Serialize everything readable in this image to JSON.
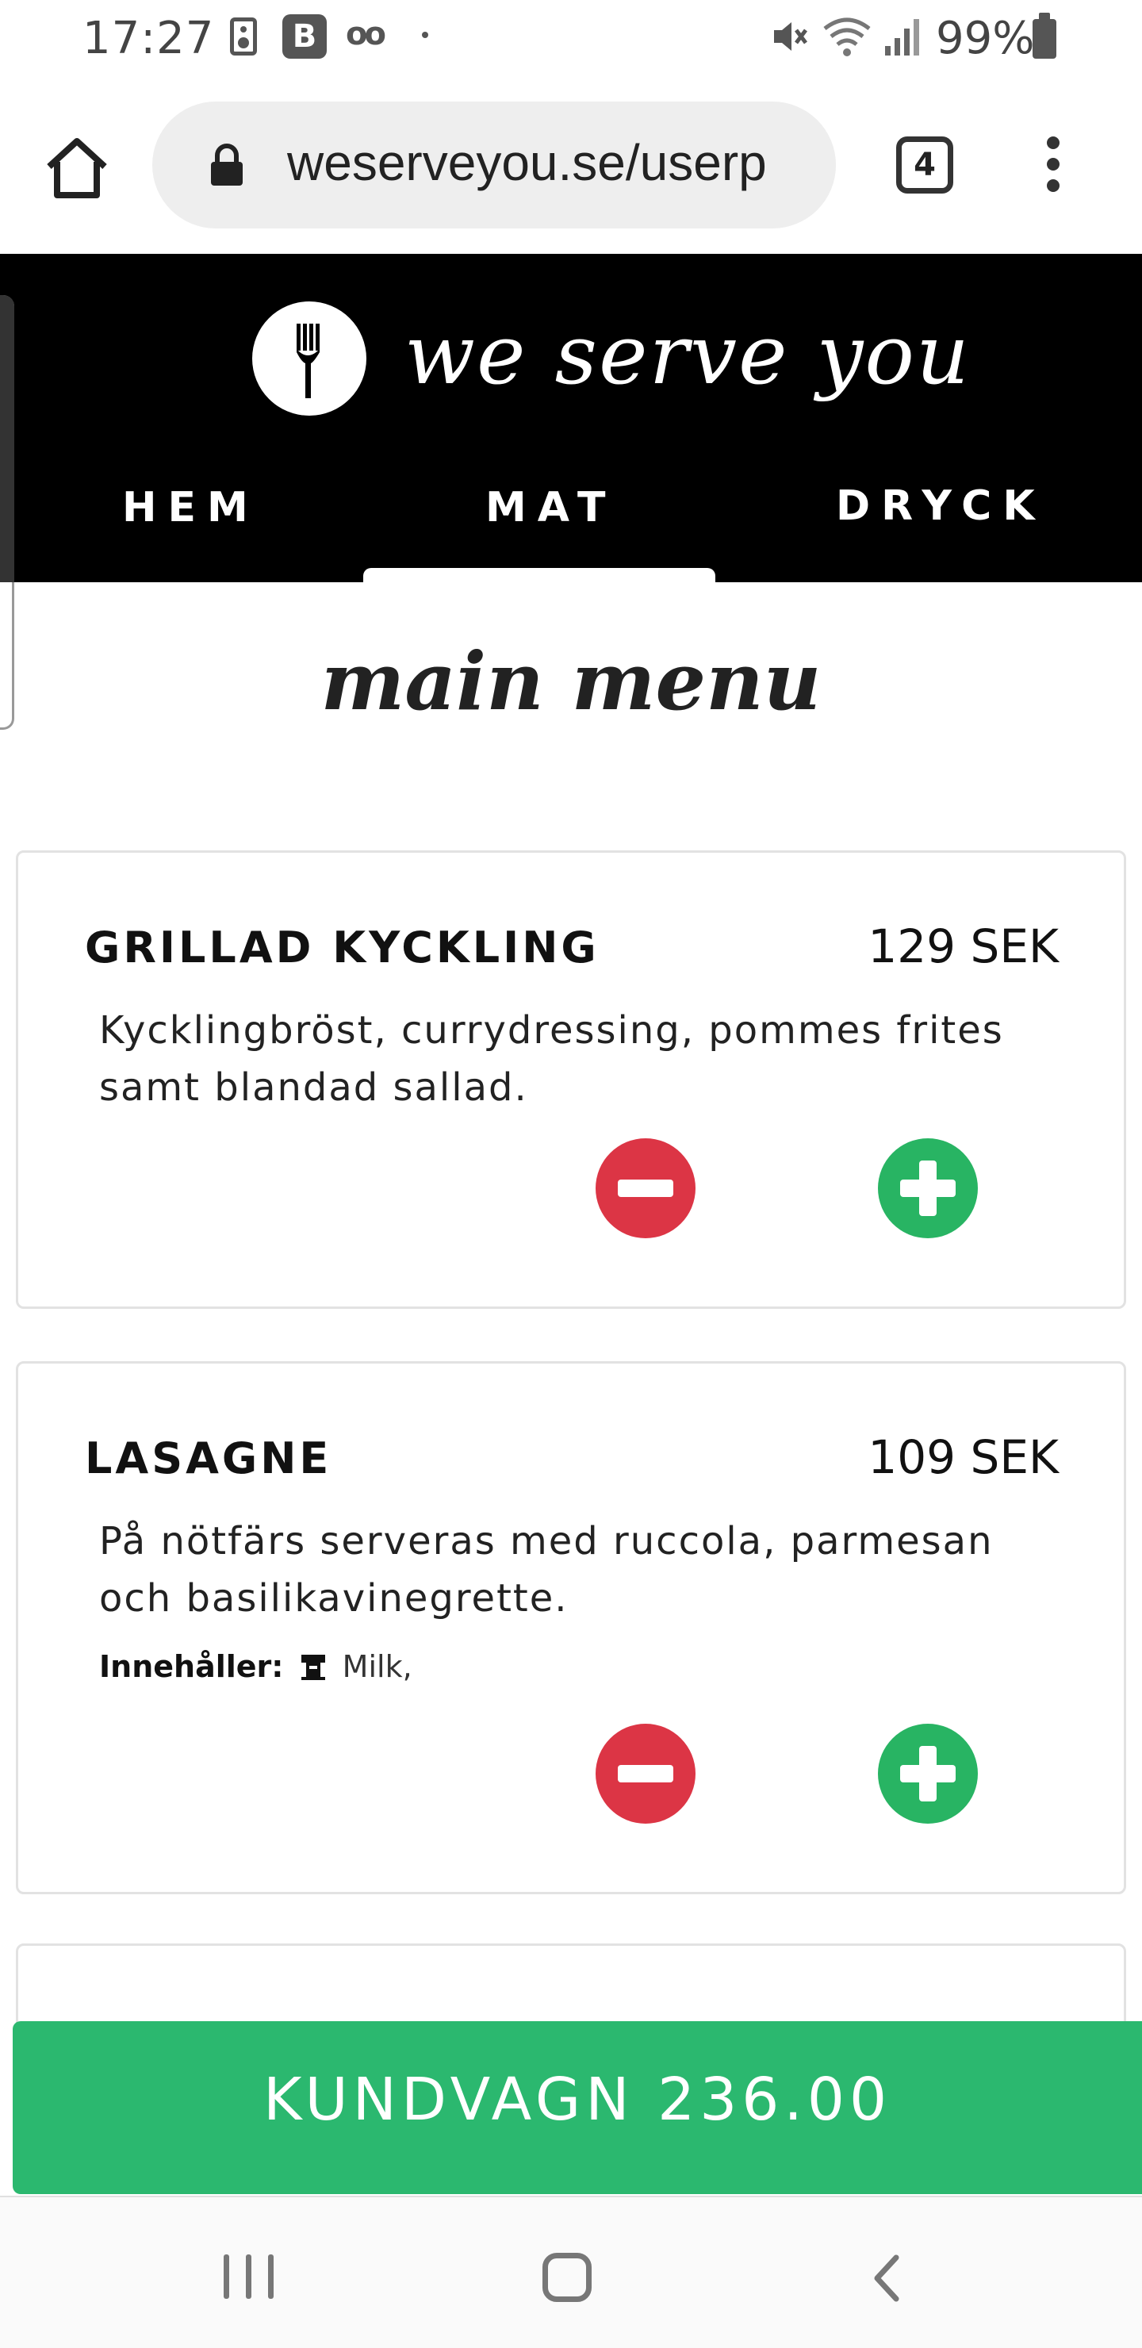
{
  "status_bar": {
    "time": "17:27",
    "b_badge": "B",
    "voicemail_glyph": "oo",
    "battery_percent": "99%",
    "icons": [
      "speaker-icon",
      "b-badge-icon",
      "voicemail-icon",
      "mute-icon",
      "wifi-icon",
      "signal-icon",
      "battery-icon"
    ]
  },
  "browser": {
    "url": "weserveyou.se/userp",
    "tab_count": "4",
    "icons": [
      "home-icon",
      "lock-icon",
      "tabs-icon",
      "more-vert-icon"
    ]
  },
  "site": {
    "logo_text": "we serve you",
    "nav": [
      {
        "label": "HEM",
        "active": false
      },
      {
        "label": "MAT",
        "active": true
      },
      {
        "label": "DRYCK",
        "active": false
      }
    ],
    "heading": "main menu"
  },
  "menu_items": [
    {
      "name": "GRILLAD KYCKLING",
      "price": "129 SEK",
      "description": "Kycklingbröst, currydressing, pommes frites samt blandad sallad."
    },
    {
      "name": "LASAGNE",
      "price": "109 SEK",
      "description": "På nötfärs serveras med ruccola, parmesan och basilikavinegrette.",
      "contains_label": "Innehåller:",
      "contains_value": "Milk,"
    }
  ],
  "cart": {
    "label": "KUNDVAGN 236.00"
  },
  "colors": {
    "header_bg": "#000000",
    "minus_red": "#dc3545",
    "plus_green": "#28b463",
    "cart_green": "#2bb86f"
  }
}
